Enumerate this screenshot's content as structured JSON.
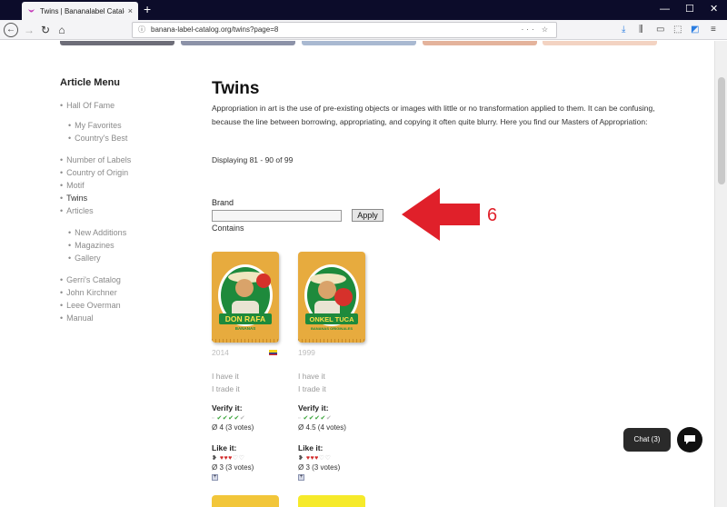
{
  "browser": {
    "tab_title": "Twins | Bananalabel Catalog",
    "tab_close": "×",
    "new_tab": "+",
    "url": "banana-label-catalog.org/twins?page=8",
    "url_info": "ⓘ",
    "url_actions": "··· ☆",
    "window_controls": {
      "minimize": "—",
      "maximize": "☐",
      "close": "✕"
    }
  },
  "sidebar": {
    "title": "Article Menu",
    "items": [
      {
        "label": "Hall Of Fame",
        "indent": false
      },
      {
        "label": "My Favorites",
        "indent": true
      },
      {
        "label": "Country's Best",
        "indent": true
      },
      {
        "label": "Number of Labels",
        "indent": false
      },
      {
        "label": "Country of Origin",
        "indent": false
      },
      {
        "label": "Motif",
        "indent": false
      },
      {
        "label": "Twins",
        "indent": false,
        "active": true
      },
      {
        "label": "Articles",
        "indent": false
      },
      {
        "label": "New Additions",
        "indent": true
      },
      {
        "label": "Magazines",
        "indent": true
      },
      {
        "label": "Gallery",
        "indent": true
      },
      {
        "label": "Gerri's Catalog",
        "indent": false
      },
      {
        "label": "John Kirchner",
        "indent": false
      },
      {
        "label": "Leee Overman",
        "indent": false
      },
      {
        "label": "Manual",
        "indent": false
      }
    ]
  },
  "main": {
    "heading": "Twins",
    "intro": "Appropriation in art is the use of pre-existing objects or images with little or no transformation applied to them. It can be confusing, because the line between borrowing, appropriating, and copying it often quite blurry. Here you find our Masters of Appropriation:",
    "displaying": "Displaying 81 - 90 of 99",
    "filter": {
      "brand_label": "Brand",
      "brand_value": "",
      "apply_label": "Apply",
      "contains_label": "Contains"
    },
    "annotation_number": "6"
  },
  "cards": [
    {
      "label_top": "DON RAFA",
      "label_bottom": "BANANAS",
      "year": "2014",
      "have": "I have it",
      "trade": "I trade it",
      "verify_title": "Verify it:",
      "verify_score": "Ø 4 (3 votes)",
      "like_title": "Like it:",
      "like_score": "Ø 3 (3 votes)",
      "checks_filled": 4,
      "hearts_filled": 3
    },
    {
      "label_top": "ONKEL TUCA",
      "label_bottom": "BANANAS ORIGINALES",
      "year": "1999",
      "have": "I have it",
      "trade": "I trade it",
      "verify_title": "Verify it:",
      "verify_score": "Ø 4.5 (4 votes)",
      "like_title": "Like it:",
      "like_score": "Ø 3 (3 votes)",
      "checks_filled": 4,
      "hearts_filled": 3
    }
  ],
  "chat": {
    "label": "Chat (3)"
  },
  "colors": {
    "accent_red": "#e0202a",
    "label_orange": "#e7ab3e",
    "check_green": "#3aa43a",
    "heart_red": "#d22a2a"
  }
}
